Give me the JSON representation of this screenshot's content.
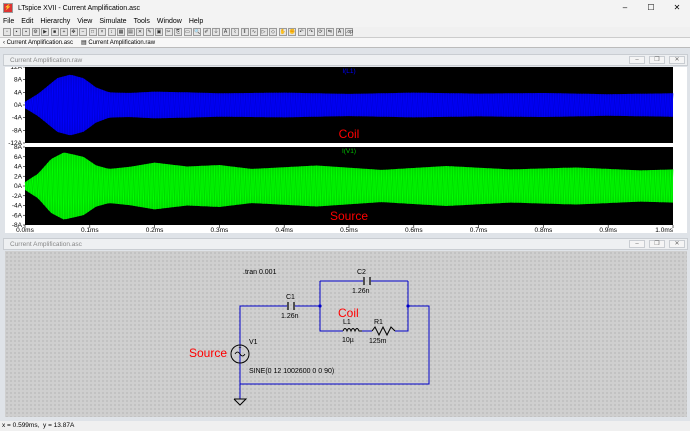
{
  "window": {
    "title": "LTspice XVII - Current Amplification.asc",
    "app_icon": "ltspice-icon"
  },
  "menu": [
    "File",
    "Edit",
    "Hierarchy",
    "View",
    "Simulate",
    "Tools",
    "Window",
    "Help"
  ],
  "tabs": [
    {
      "label": "Current Amplification.asc",
      "icon": "schematic-icon"
    },
    {
      "label": "Current Amplification.raw",
      "icon": "waveform-icon"
    }
  ],
  "waveform_pane": {
    "title": "Current Amplification.raw"
  },
  "schematic_pane": {
    "title": "Current Amplification.asc"
  },
  "chart_data": [
    {
      "type": "line",
      "title": "I(L1)",
      "color": "#0000ff",
      "annotation": "Coil",
      "y_ticks": [
        "12A",
        "8A",
        "4A",
        "0A",
        "-4A",
        "-8A",
        "-12A"
      ],
      "ylim": [
        -12,
        12
      ],
      "xlim_ms": [
        0,
        1.0
      ],
      "grid": false,
      "envelope_points": [
        [
          0,
          1.0
        ],
        [
          0.02,
          3.5
        ],
        [
          0.05,
          8.5
        ],
        [
          0.07,
          9.6
        ],
        [
          0.09,
          8.5
        ],
        [
          0.11,
          5.5
        ],
        [
          0.13,
          4.0
        ],
        [
          0.16,
          3.8
        ],
        [
          0.2,
          4.2
        ],
        [
          0.25,
          4.0
        ],
        [
          0.3,
          3.7
        ],
        [
          0.4,
          3.9
        ],
        [
          0.5,
          3.5
        ],
        [
          0.6,
          3.9
        ],
        [
          0.7,
          3.6
        ],
        [
          0.8,
          3.8
        ],
        [
          0.9,
          3.4
        ],
        [
          1.0,
          3.7
        ]
      ]
    },
    {
      "type": "line",
      "title": "I(V1)",
      "color": "#00ff00",
      "annotation": "Source",
      "y_ticks": [
        "8A",
        "6A",
        "4A",
        "2A",
        "0A",
        "-2A",
        "-4A",
        "-6A",
        "-8A"
      ],
      "ylim": [
        -8,
        8
      ],
      "xlim_ms": [
        0,
        1.0
      ],
      "grid": false,
      "envelope_points": [
        [
          0,
          0.8
        ],
        [
          0.02,
          2.5
        ],
        [
          0.04,
          5.5
        ],
        [
          0.06,
          6.9
        ],
        [
          0.09,
          6.0
        ],
        [
          0.11,
          4.2
        ],
        [
          0.13,
          3.5
        ],
        [
          0.16,
          3.9
        ],
        [
          0.2,
          4.8
        ],
        [
          0.25,
          4.0
        ],
        [
          0.3,
          4.3
        ],
        [
          0.35,
          3.5
        ],
        [
          0.45,
          4.2
        ],
        [
          0.55,
          3.3
        ],
        [
          0.65,
          4.1
        ],
        [
          0.75,
          3.4
        ],
        [
          0.85,
          3.8
        ],
        [
          0.95,
          3.2
        ],
        [
          1.0,
          3.4
        ]
      ]
    }
  ],
  "x_ticks": [
    "0.0ms",
    "0.1ms",
    "0.2ms",
    "0.3ms",
    "0.4ms",
    "0.5ms",
    "0.6ms",
    "0.7ms",
    "0.8ms",
    "0.9ms",
    "1.0ms"
  ],
  "schematic": {
    "directive": ".tran 0.001",
    "c2_name": "C2",
    "c2_value": "1.26n",
    "c1_name": "C1",
    "c1_value": "1.26n",
    "l1_name": "L1",
    "l1_value": "10µ",
    "r1_name": "R1",
    "r1_value": "125m",
    "v1_name": "V1",
    "v1_value": "SINE(0 12 1002600 0 0 90)",
    "coil_label": "Coil",
    "source_label": "Source",
    "wire_color": "#0000c8",
    "label_color": "#ff0000"
  },
  "status": {
    "x": "x = 0.599ms",
    "y": "y = 13.87A"
  }
}
